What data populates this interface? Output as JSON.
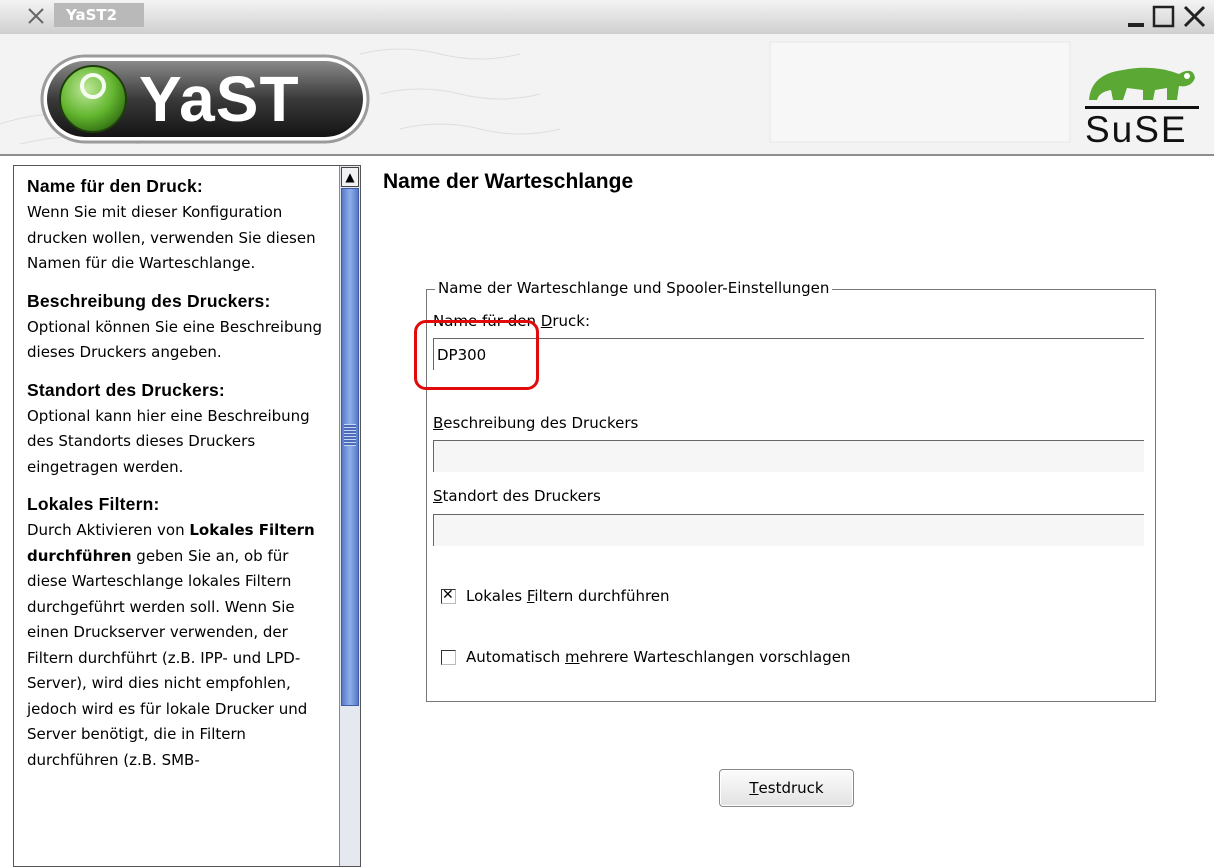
{
  "window": {
    "title": "YaST2"
  },
  "banner": {
    "app_logo_text": "YaST",
    "brand_logo_text": "SuSE"
  },
  "help": {
    "sections": [
      {
        "heading": "Name für den Druck:",
        "text": "Wenn Sie mit dieser Konfiguration drucken wollen, verwenden Sie diesen Namen für die Warteschlange."
      },
      {
        "heading": "Beschreibung des Druckers:",
        "text": "Optional können Sie eine Beschreibung dieses Druckers angeben."
      },
      {
        "heading": "Standort des Druckers:",
        "text": "Optional kann hier eine Beschreibung des Standorts dieses Druckers eingetragen werden."
      },
      {
        "heading": "Lokales Filtern:",
        "text_prefix": "Durch Aktivieren von ",
        "text_bold": "Lokales Filtern durchführen",
        "text_suffix": " geben Sie an, ob für diese Warteschlange lokales Filtern durchgeführt werden soll. Wenn Sie einen Druckserver verwenden, der Filtern durchführt (z.B. IPP- und LPD-Server), wird dies nicht empfohlen, jedoch wird es für lokale Drucker und Server benötigt, die in Filtern durchführen (z.B. SMB-"
      }
    ]
  },
  "main": {
    "title": "Name der Warteschlange",
    "group_title": "Name der Warteschlange und Spooler-Einstellungen",
    "queue_name": {
      "label_pre": "Name für den ",
      "label_u": "D",
      "label_post": "ruck:",
      "value": "DP300"
    },
    "description": {
      "label_u": "B",
      "label_post": "eschreibung des Druckers",
      "value": ""
    },
    "location": {
      "label_u": "S",
      "label_post": "tandort des Druckers",
      "value": ""
    },
    "local_filter": {
      "label_pre": "Lokales ",
      "label_u": "F",
      "label_post": "iltern durchführen",
      "checked": true
    },
    "auto_queues": {
      "label_pre": "Automatisch ",
      "label_u": "m",
      "label_post": "ehrere Warteschlangen vorschlagen",
      "checked": false
    },
    "test_button": {
      "label_u": "T",
      "label_post": "estdruck"
    }
  },
  "colors": {
    "highlight": "#e10b0b",
    "scroll_thumb": "#5679c9",
    "yast_green": "#62b52e"
  },
  "icons": [
    "close-x-icon",
    "minimize-icon",
    "maximize-icon",
    "window-close-icon",
    "scroll-up-arrow-icon",
    "chameleon-logo-icon"
  ]
}
